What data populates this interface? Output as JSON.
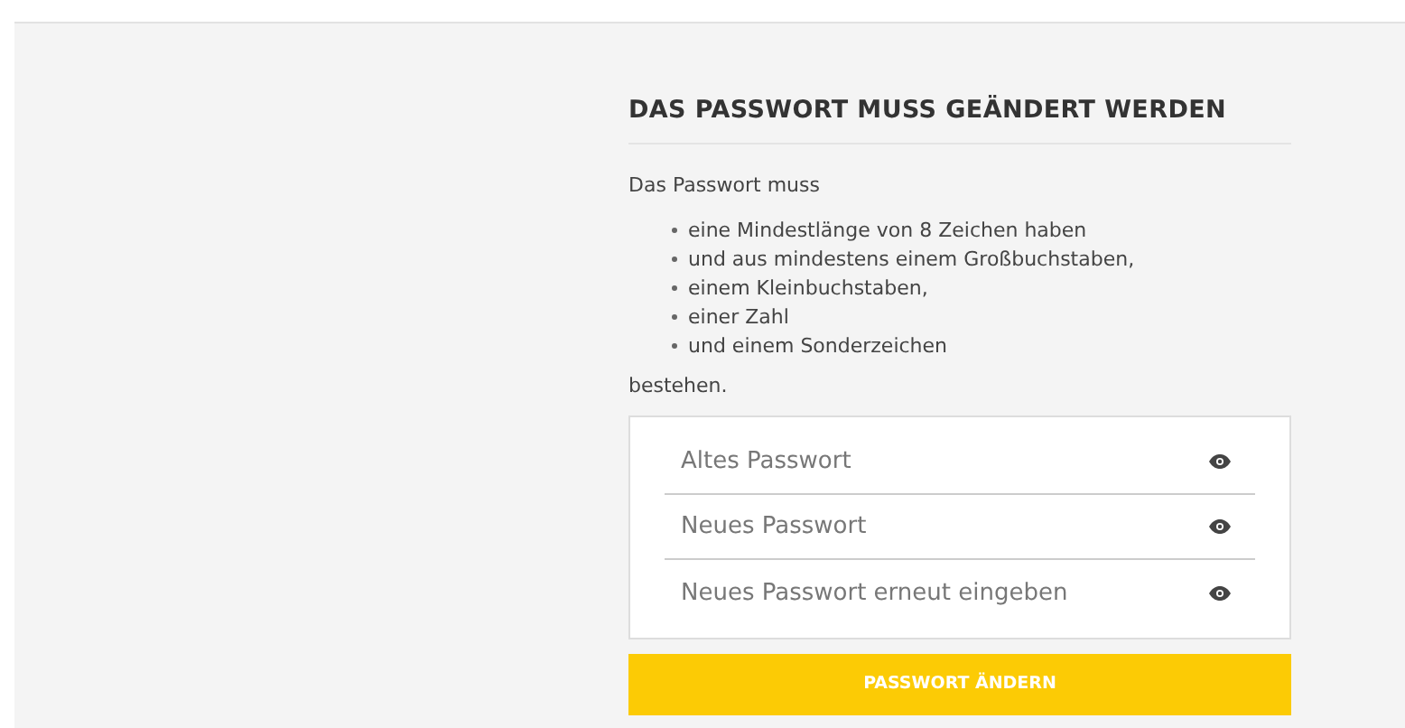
{
  "heading": "DAS PASSWORT MUSS GEÄNDERT WERDEN",
  "intro": "Das Passwort muss",
  "rules": [
    "eine Mindestlänge von 8 Zeichen haben",
    "und aus mindestens einem Großbuchstaben,",
    "einem Kleinbuchstaben,",
    "einer Zahl",
    "und einem Sonderzeichen"
  ],
  "outro": "bestehen.",
  "fields": [
    {
      "placeholder": "Altes Passwort"
    },
    {
      "placeholder": "Neues Passwort"
    },
    {
      "placeholder": "Neues Passwort erneut eingeben"
    }
  ],
  "submit": "PASSWORT ÄNDERN"
}
